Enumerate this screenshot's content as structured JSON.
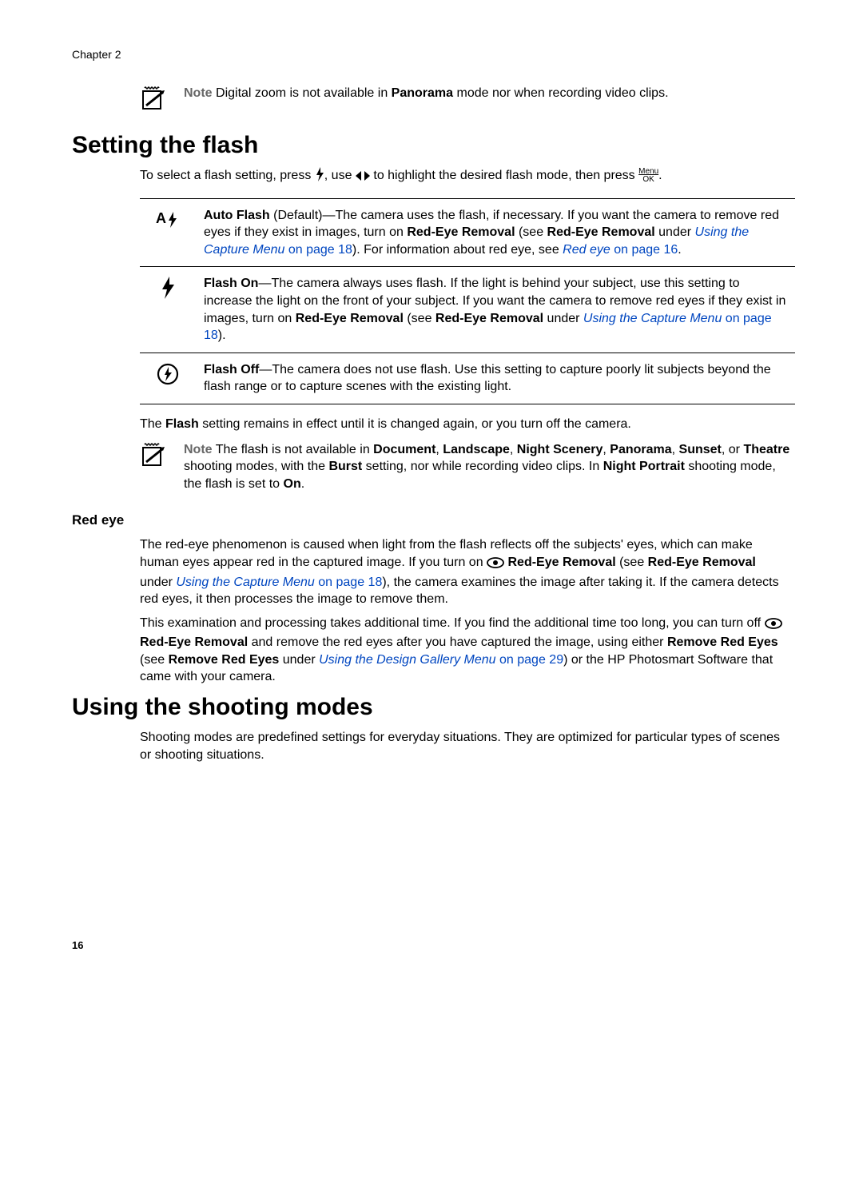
{
  "chapter": "Chapter 2",
  "note1": {
    "label": "Note",
    "text_before": "  Digital zoom is not available in ",
    "panorama": "Panorama",
    "text_after": " mode nor when recording video clips."
  },
  "heading_flash": "Setting the flash",
  "flash_intro_a": "To select a flash setting, press ",
  "flash_intro_b": ", use ",
  "flash_intro_c": " to highlight the desired flash mode, then press ",
  "flash_intro_d": ".",
  "menuok_top": "Menu",
  "menuok_bottom": "OK",
  "row_autoflash": {
    "bold_a": "Auto Flash",
    "txt_a": " (Default)—The camera uses the flash, if necessary. If you want the camera to remove red eyes if they exist in images, turn on ",
    "bold_b": "Red-Eye Removal",
    "txt_b": " (see ",
    "bold_c": "Red-Eye Removal",
    "txt_c": " under ",
    "link_a": "Using the Capture Menu",
    "link_b": " on page 18",
    "txt_d": "). For information about red eye, see ",
    "link_c": "Red eye",
    "link_d": " on page 16",
    "txt_e": "."
  },
  "row_flashon": {
    "bold_a": "Flash On",
    "txt_a": "—The camera always uses flash. If the light is behind your subject, use this setting to increase the light on the front of your subject. If you want the camera to remove red eyes if they exist in images, turn on ",
    "bold_b": "Red-Eye Removal",
    "txt_b": " (see ",
    "bold_c": "Red-Eye Removal",
    "txt_c": " under ",
    "link_a": "Using the Capture Menu",
    "link_b": " on page 18",
    "txt_d": ")."
  },
  "row_flashoff": {
    "bold_a": "Flash Off",
    "txt_a": "—The camera does not use flash. Use this setting to capture poorly lit subjects beyond the flash range or to capture scenes with the existing light."
  },
  "flash_persist_a": "The ",
  "flash_persist_b": "Flash",
  "flash_persist_c": " setting remains in effect until it is changed again, or you turn off the camera.",
  "note2": {
    "label": "Note",
    "txt_a": "  The flash is not available in ",
    "b1": "Document",
    "b2": "Landscape",
    "b3": "Night Scenery",
    "b4": "Panorama",
    "b5": "Sunset",
    "b6": "Theatre",
    "txt_b": " shooting modes, with the ",
    "b7": "Burst",
    "txt_c": " setting, nor while recording video clips. In ",
    "b8": "Night Portrait",
    "txt_d": " shooting mode, the flash is set to ",
    "b9": "On",
    "txt_e": "."
  },
  "heading_redeye": "Red eye",
  "redeye_p1": {
    "txt_a": "The red-eye phenomenon is caused when light from the flash reflects off the subjects' eyes, which can make human eyes appear red in the captured image. If you turn on ",
    "bold_a": " Red-Eye Removal",
    "txt_b": " (see ",
    "bold_b": "Red-Eye Removal",
    "txt_c": " under ",
    "link_a": "Using the Capture Menu",
    "link_b": " on page 18",
    "txt_d": "), the camera examines the image after taking it. If the camera detects red eyes, it then processes the image to remove them."
  },
  "redeye_p2": {
    "txt_a": "This examination and processing takes additional time. If you find the additional time too long, you can turn off ",
    "bold_a": " Red-Eye Removal",
    "txt_b": " and remove the red eyes after you have captured the image, using either ",
    "bold_b": "Remove Red Eyes",
    "txt_c": " (see ",
    "bold_c": "Remove Red Eyes",
    "txt_d": " under ",
    "link_a": "Using the Design Gallery Menu",
    "link_b": " on page 29",
    "txt_e": ") or the HP Photosmart Software that came with your camera."
  },
  "heading_modes": "Using the shooting modes",
  "modes_p1": "Shooting modes are predefined settings for everyday situations. They are optimized for particular types of scenes or shooting situations.",
  "page_number": "16"
}
